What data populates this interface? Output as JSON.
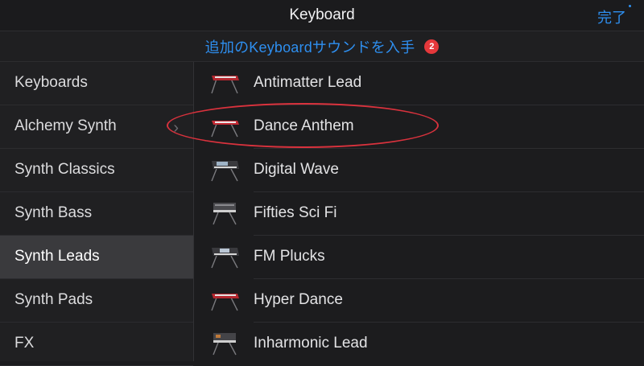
{
  "header": {
    "title": "Keyboard",
    "done_label": "完了"
  },
  "banner": {
    "text": "追加のKeyboardサウンドを入手",
    "badge_count": "2"
  },
  "sidebar": {
    "items": [
      {
        "label": "Keyboards"
      },
      {
        "label": "Alchemy Synth"
      },
      {
        "label": "Synth Classics"
      },
      {
        "label": "Synth Bass"
      },
      {
        "label": "Synth Leads",
        "selected": true
      },
      {
        "label": "Synth Pads"
      },
      {
        "label": "FX"
      }
    ]
  },
  "list": {
    "items": [
      {
        "label": "Antimatter Lead",
        "icon": "red-synth-keyboard-icon"
      },
      {
        "label": "Dance Anthem",
        "icon": "red-synth-keyboard-icon",
        "highlighted": true
      },
      {
        "label": "Digital Wave",
        "icon": "workstation-keyboard-icon"
      },
      {
        "label": "Fifties Sci Fi",
        "icon": "vintage-synth-keyboard-icon"
      },
      {
        "label": "FM Plucks",
        "icon": "workstation-keyboard-icon"
      },
      {
        "label": "Hyper Dance",
        "icon": "red-synth-keyboard-icon"
      },
      {
        "label": "Inharmonic Lead",
        "icon": "vintage-synth-keyboard-icon"
      }
    ]
  },
  "colors": {
    "accent": "#2e8ff0",
    "badge": "#e5383b",
    "highlight_ring": "#d9323d",
    "background": "#1c1c1e",
    "selected_row": "#3a3a3d"
  }
}
